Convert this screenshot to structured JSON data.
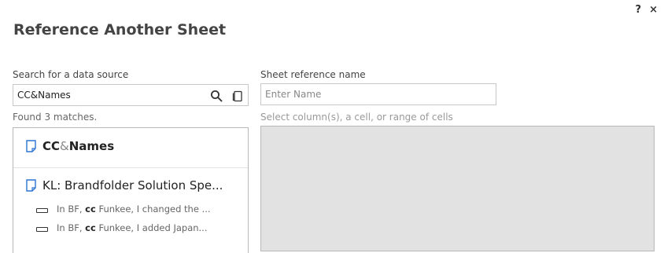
{
  "header": {
    "help_icon": "?",
    "close_icon": "×"
  },
  "dialog": {
    "title": "Reference Another Sheet"
  },
  "search": {
    "label": "Search for a data source",
    "value": "CC&Names",
    "placeholder": "",
    "matches_text": "Found 3 matches."
  },
  "reference": {
    "label": "Sheet reference name",
    "value": "",
    "placeholder": "Enter Name",
    "select_hint": "Select column(s), a cell, or range of cells"
  },
  "results": [
    {
      "prefix_bold": "CC",
      "middle": "&",
      "suffix_bold": "Names"
    },
    {
      "name": "KL: Brandfolder Solution Spe..."
    }
  ],
  "rows": [
    {
      "before": "In BF, ",
      "match": "cc",
      "after": " Funkee, I changed the ..."
    },
    {
      "before": "In BF, ",
      "match": "cc",
      "after": " Funkee, I added Japan..."
    }
  ],
  "colors": {
    "doc_icon": "#2c73d2",
    "grid_bg": "#e2e2e2"
  }
}
